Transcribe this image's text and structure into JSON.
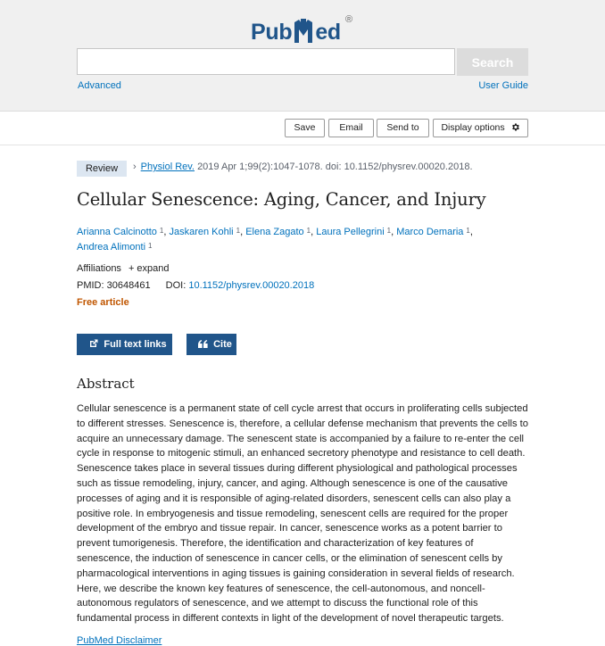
{
  "header": {
    "logo_pub": "Pub",
    "logo_ed": "ed",
    "logo_reg": "®",
    "search_value": "",
    "search_button": "Search",
    "advanced_link": "Advanced",
    "user_guide_link": "User Guide"
  },
  "actions": {
    "save": "Save",
    "email": "Email",
    "send_to": "Send to",
    "display_options": "Display options"
  },
  "article": {
    "type_badge": "Review",
    "journal": "Physiol Rev.",
    "citation": "2019 Apr 1;99(2):1047-1078. doi: 10.1152/physrev.00020.2018.",
    "title": "Cellular Senescence: Aging, Cancer, and Injury",
    "authors": [
      {
        "name": "Arianna Calcinotto",
        "aff": "1"
      },
      {
        "name": "Jaskaren Kohli",
        "aff": "1"
      },
      {
        "name": "Elena Zagato",
        "aff": "1"
      },
      {
        "name": "Laura Pellegrini",
        "aff": "1"
      },
      {
        "name": "Marco Demaria",
        "aff": "1"
      },
      {
        "name": "Andrea Alimonti",
        "aff": "1"
      }
    ],
    "affiliations_label": "Affiliations",
    "expand_label": "expand",
    "pmid_label": "PMID:",
    "pmid": "30648461",
    "doi_label": "DOI:",
    "doi": "10.1152/physrev.00020.2018",
    "free_label": "Free article",
    "full_text_button": "Full text links",
    "cite_button": "Cite"
  },
  "abstract": {
    "heading": "Abstract",
    "text": "Cellular senescence is a permanent state of cell cycle arrest that occurs in proliferating cells subjected to different stresses. Senescence is, therefore, a cellular defense mechanism that prevents the cells to acquire an unnecessary damage. The senescent state is accompanied by a failure to re-enter the cell cycle in response to mitogenic stimuli, an enhanced secretory phenotype and resistance to cell death. Senescence takes place in several tissues during different physiological and pathological processes such as tissue remodeling, injury, cancer, and aging. Although senescence is one of the causative processes of aging and it is responsible of aging-related disorders, senescent cells can also play a positive role. In embryogenesis and tissue remodeling, senescent cells are required for the proper development of the embryo and tissue repair. In cancer, senescence works as a potent barrier to prevent tumorigenesis. Therefore, the identification and characterization of key features of senescence, the induction of senescence in cancer cells, or the elimination of senescent cells by pharmacological interventions in aging tissues is gaining consideration in several fields of research. Here, we describe the known key features of senescence, the cell-autonomous, and noncell-autonomous regulators of senescence, and we attempt to discuss the functional role of this fundamental process in different contexts in light of the development of novel therapeutic targets."
  },
  "footer_cut_link": "PubMed Disclaimer",
  "colors": {
    "brand_blue": "#20558a",
    "link_blue": "#0071bc",
    "free_orange": "#c05600",
    "header_bg": "#f0f0f0",
    "badge_bg": "#dce6f1"
  }
}
